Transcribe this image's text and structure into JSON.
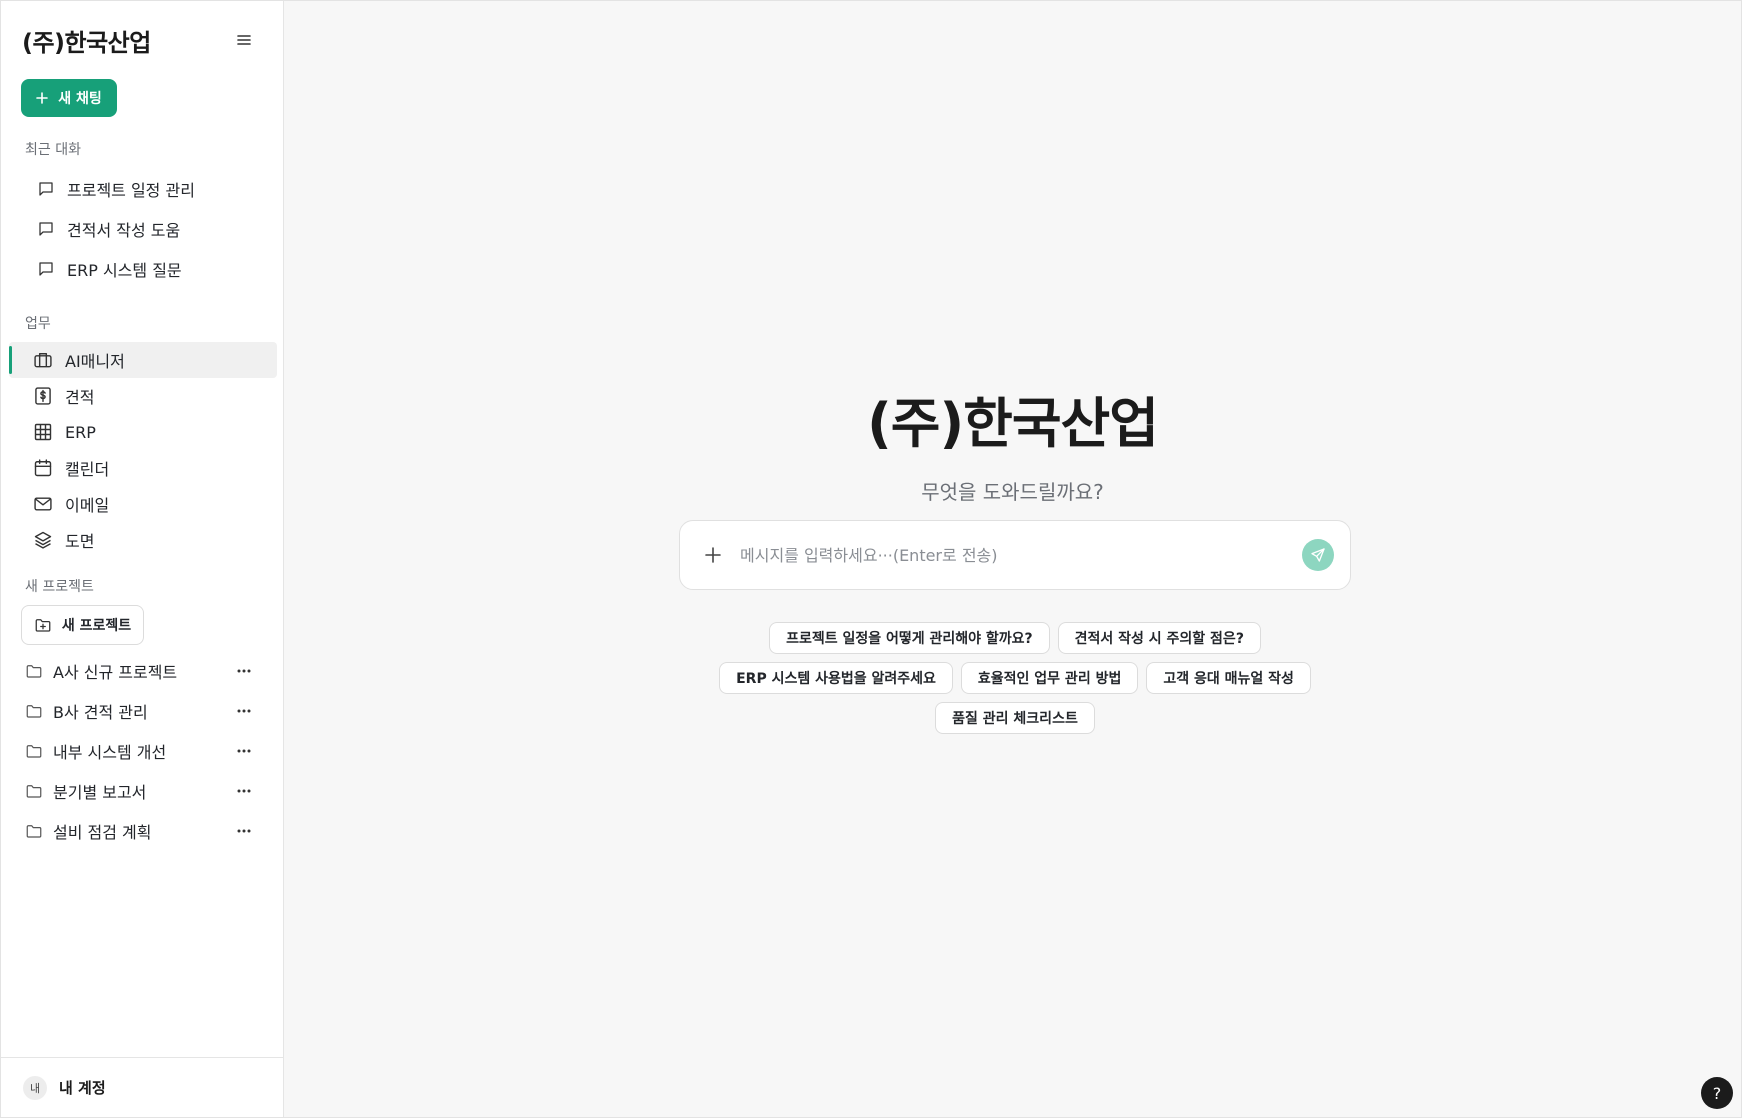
{
  "sidebar": {
    "brand": "(주)한국산업",
    "new_chat_label": "새 채팅",
    "recent_label": "최근 대화",
    "recent_chats": [
      {
        "label": "프로젝트 일정 관리",
        "icon": "chat-bubble-icon"
      },
      {
        "label": "견적서 작성 도움",
        "icon": "chat-bubble-icon"
      },
      {
        "label": "ERP 시스템 질문",
        "icon": "chat-bubble-icon"
      }
    ],
    "work_label": "업무",
    "work_items": [
      {
        "label": "AI매니저",
        "icon": "briefcase-icon",
        "active": true
      },
      {
        "label": "견적",
        "icon": "dollar-document-icon",
        "active": false
      },
      {
        "label": "ERP",
        "icon": "grid-table-icon",
        "active": false
      },
      {
        "label": "캘린더",
        "icon": "calendar-icon",
        "active": false
      },
      {
        "label": "이메일",
        "icon": "mail-icon",
        "active": false
      },
      {
        "label": "도면",
        "icon": "layers-icon",
        "active": false
      }
    ],
    "projects_label": "새 프로젝트",
    "new_project_label": "새 프로젝트",
    "projects": [
      {
        "label": "A사 신규 프로젝트",
        "icon": "folder-icon"
      },
      {
        "label": "B사 견적 관리",
        "icon": "folder-icon"
      },
      {
        "label": "내부 시스템 개선",
        "icon": "folder-icon"
      },
      {
        "label": "분기별 보고서",
        "icon": "folder-icon"
      },
      {
        "label": "설비 점검 계획",
        "icon": "folder-icon"
      }
    ],
    "account": {
      "avatar_text": "내",
      "label": "내 계정"
    }
  },
  "main": {
    "title": "(주)한국산업",
    "subtitle": "무엇을 도와드릴까요?",
    "input_placeholder": "메시지를 입력하세요···(Enter로 전송)",
    "suggestions": [
      [
        "프로젝트 일정을 어떻게 관리해야 할까요?",
        "견적서 작성 시 주의할 점은?"
      ],
      [
        "ERP 시스템 사용법을 알려주세요",
        "효율적인 업무 관리 방법",
        "고객 응대 매뉴얼 작성"
      ],
      [
        "품질 관리 체크리스트"
      ]
    ],
    "help_label": "?"
  },
  "colors": {
    "accent": "#17a079",
    "send_button": "#8dd6c0",
    "active_row": "#f0f0f0",
    "background": "#f7f7f7"
  }
}
